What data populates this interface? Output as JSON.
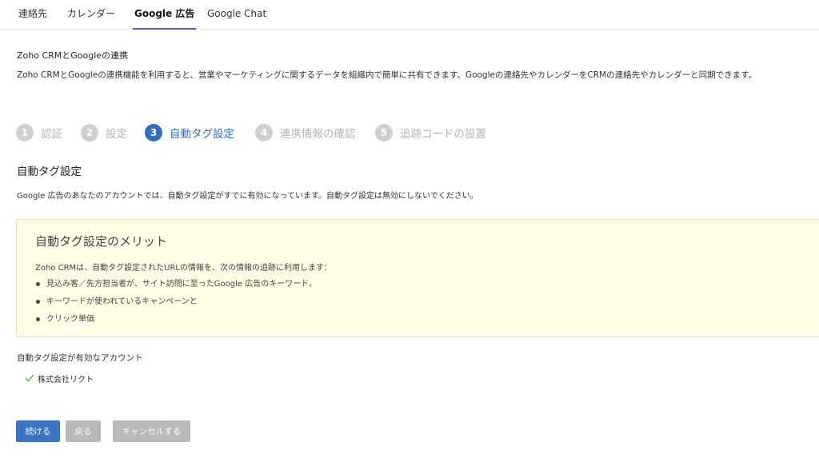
{
  "tabs": [
    {
      "label": "連絡先"
    },
    {
      "label": "カレンダー"
    },
    {
      "label": "Google 広告"
    },
    {
      "label": "Google Chat"
    }
  ],
  "active_tab": "Google 広告",
  "section": {
    "title": "Zoho CRMとGoogleの連携",
    "description": "Zoho CRMとGoogleの連携機能を利用すると、営業やマーケティングに関するデータを組織内で簡単に共有できます。Googleの連絡先やカレンダーをCRMの連絡先やカレンダーと同期できます。"
  },
  "stepper": {
    "current_step": 3,
    "steps": [
      {
        "num": "1",
        "label": "認証"
      },
      {
        "num": "2",
        "label": "設定"
      },
      {
        "num": "3",
        "label": "自動タグ設定"
      },
      {
        "num": "4",
        "label": "連携情報の確認"
      },
      {
        "num": "5",
        "label": "追跡コードの設置"
      }
    ]
  },
  "page": {
    "heading": "自動タグ設定",
    "note": "Google 広告のあなたのアカウントでは、自動タグ設定がすでに有効になっています。自動タグ設定は無効にしないでください。"
  },
  "benefits": {
    "title": "自動タグ設定のメリット",
    "lead": "Zoho CRMは、自動タグ設定されたURLの情報を、次の情報の追跡に利用します：",
    "items": [
      "見込み客／先方担当者が、サイト訪問に至ったGoogle 広告のキーワード。",
      "キーワードが使われているキャンペーンと",
      "クリック単価"
    ]
  },
  "accounts": {
    "heading": "自動タグ設定が有効なアカウント",
    "items": [
      {
        "name": "株式会社リクト",
        "icon": "check-icon"
      }
    ]
  },
  "buttons": {
    "continue": "続ける",
    "back": "戻る",
    "cancel": "キャンセルする"
  },
  "colors": {
    "accent": "#2f6ec4",
    "tab_underline": "#5b53d8",
    "inactive_step": "#cfcfcf",
    "benefit_bg": "#fefde6",
    "check": "#6bbf4e",
    "primary_button": "#3a74c2",
    "grey_button": "#b9b9b9"
  }
}
